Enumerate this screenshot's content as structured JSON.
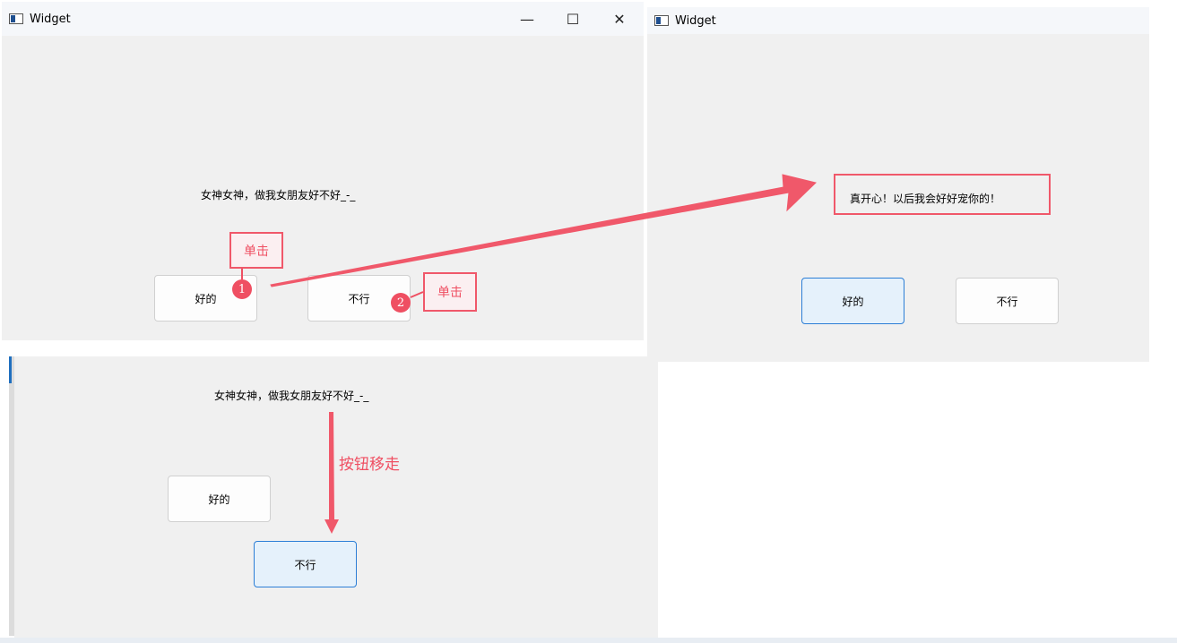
{
  "window1": {
    "title": "Widget",
    "question": "女神女神，做我女朋友好不好_-_",
    "yes_label": "好的",
    "no_label": "不行",
    "controls": {
      "minimize": "—",
      "maximize": "☐",
      "close": "✕"
    }
  },
  "window2": {
    "title": "Widget",
    "message": "真开心！以后我会好好宠你的！",
    "yes_label": "好的",
    "no_label": "不行"
  },
  "window3": {
    "question": "女神女神，做我女朋友好不好_-_",
    "yes_label": "好的",
    "no_label": "不行"
  },
  "annotations": {
    "click_label_1": "单击",
    "click_label_2": "单击",
    "step1": "1",
    "step2": "2",
    "move_label": "按钮移走",
    "accent_color": "#ef4f62"
  }
}
